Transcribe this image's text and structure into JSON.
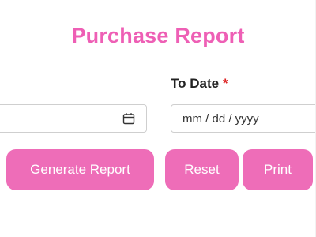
{
  "title": "Purchase Report",
  "to_date": {
    "label": "To Date",
    "required_mark": "*",
    "placeholder": "mm / dd / yyyy"
  },
  "from_date": {
    "icon": "calendar-icon"
  },
  "buttons": {
    "generate": "Generate Report",
    "reset": "Reset",
    "print": "Print"
  },
  "colors": {
    "accent": "#ee6db8",
    "title": "#ee5fb5",
    "required": "#dd2222"
  }
}
